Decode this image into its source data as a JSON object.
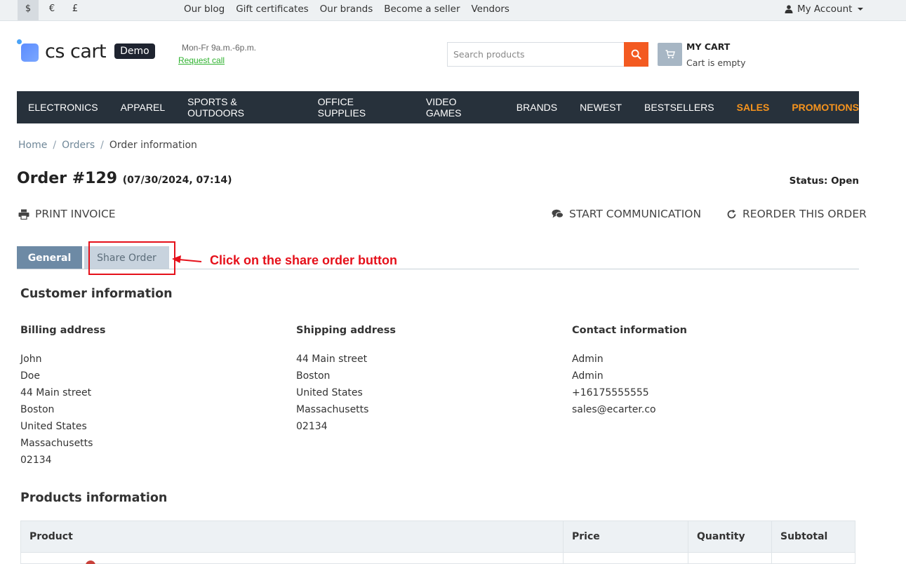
{
  "topbar": {
    "currencies": [
      "$",
      "€",
      "£"
    ],
    "links": [
      "Our blog",
      "Gift certificates",
      "Our brands",
      "Become a seller",
      "Vendors"
    ],
    "account": "My Account"
  },
  "header": {
    "logo_text": "cs cart",
    "demo_badge": "Demo",
    "hours": "Mon-Fr 9a.m.-6p.m.",
    "request_call": "Request call",
    "search_placeholder": "Search products",
    "cart_title": "MY CART",
    "cart_status": "Cart is empty"
  },
  "nav": {
    "items": [
      "ELECTRONICS",
      "APPAREL",
      "SPORTS & OUTDOORS",
      "OFFICE SUPPLIES",
      "VIDEO GAMES",
      "BRANDS",
      "NEWEST",
      "BESTSELLERS"
    ],
    "highlight_items": [
      "SALES",
      "PROMOTIONS"
    ],
    "highlight_color": "#f7941d"
  },
  "breadcrumb": [
    "Home",
    "Orders",
    "Order information"
  ],
  "order": {
    "title": "Order #129",
    "date": "(07/30/2024, 07:14)",
    "status": "Status: Open"
  },
  "actions": {
    "print": "PRINT INVOICE",
    "communication": "START COMMUNICATION",
    "reorder": "REORDER THIS ORDER"
  },
  "tabs": {
    "general": "General",
    "share": "Share Order"
  },
  "annotation": {
    "text": "Click on the share order button",
    "color": "#e5101a"
  },
  "customer": {
    "heading": "Customer information",
    "billing": {
      "title": "Billing address",
      "lines": [
        "John",
        "Doe",
        "44 Main street",
        "Boston",
        "United States",
        "Massachusetts",
        "02134"
      ]
    },
    "shipping": {
      "title": "Shipping address",
      "lines": [
        "44 Main street",
        "Boston",
        "United States",
        "Massachusetts",
        "02134"
      ]
    },
    "contact": {
      "title": "Contact information",
      "lines": [
        "Admin",
        "Admin",
        "+16175555555",
        "sales@ecarter.co"
      ]
    }
  },
  "products": {
    "heading": "Products information",
    "columns": [
      "Product",
      "Price",
      "Quantity",
      "Subtotal"
    ]
  }
}
